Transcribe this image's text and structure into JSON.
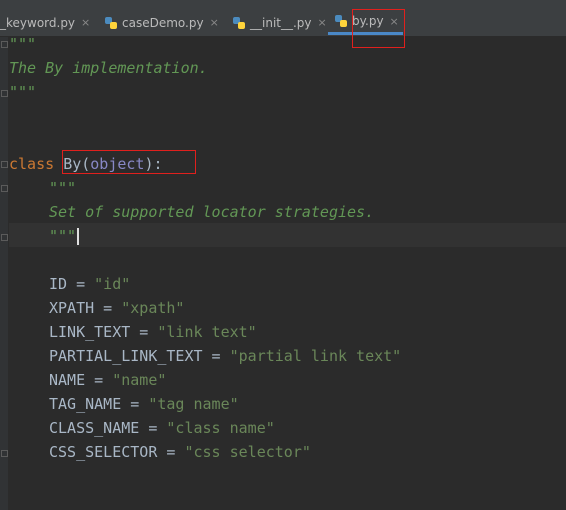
{
  "tabs": [
    {
      "label": "_keyword.py",
      "close": "×"
    },
    {
      "label": "caseDemo.py",
      "close": "×"
    },
    {
      "label": "__init__.py",
      "close": "×"
    },
    {
      "label": "by.py",
      "close": "×"
    }
  ],
  "code": {
    "l1": "\"\"\"",
    "l2": "The By implementation.",
    "l3": "\"\"\"",
    "class_kw": "class",
    "class_name": "By(",
    "class_base": "object",
    "class_end": "):",
    "doc_open": "\"\"\"",
    "doc_text": "Set of supported locator strategies.",
    "doc_close": "\"\"\"",
    "assignments": [
      {
        "name": "ID",
        "value": "\"id\""
      },
      {
        "name": "XPATH",
        "value": "\"xpath\""
      },
      {
        "name": "LINK_TEXT",
        "value": "\"link text\""
      },
      {
        "name": "PARTIAL_LINK_TEXT",
        "value": "\"partial link text\""
      },
      {
        "name": "NAME",
        "value": "\"name\""
      },
      {
        "name": "TAG_NAME",
        "value": "\"tag name\""
      },
      {
        "name": "CLASS_NAME",
        "value": "\"class name\""
      },
      {
        "name": "CSS_SELECTOR",
        "value": "\"css selector\""
      }
    ]
  },
  "icons": {
    "tab_file": "python-file-icon",
    "tab_close": "close-icon"
  },
  "colors": {
    "highlight_box": "#e0201d",
    "active_tab": "#4a88c7"
  }
}
